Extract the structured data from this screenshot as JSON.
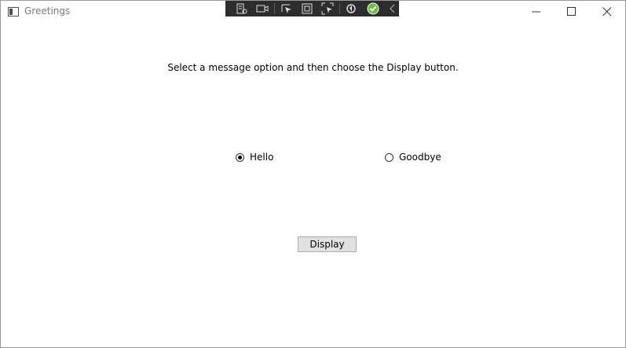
{
  "window": {
    "title": "Greetings"
  },
  "devtools": {
    "tools": [
      "live-visual-tree-icon",
      "record-icon",
      "select-element-icon",
      "display-layout-adorners-icon",
      "track-focus-icon",
      "hot-reload-icon",
      "check-icon",
      "collapse-chevron-icon"
    ],
    "accent": "#2d2d30"
  },
  "content": {
    "instruction": "Select a message option and then choose the Display button.",
    "options": [
      {
        "label": "Hello",
        "checked": true
      },
      {
        "label": "Goodbye",
        "checked": false
      }
    ],
    "display_button": "Display"
  },
  "colors": {
    "button_bg": "#e1e1e1",
    "button_border": "#adadad",
    "check_green": "#6abf3e"
  }
}
